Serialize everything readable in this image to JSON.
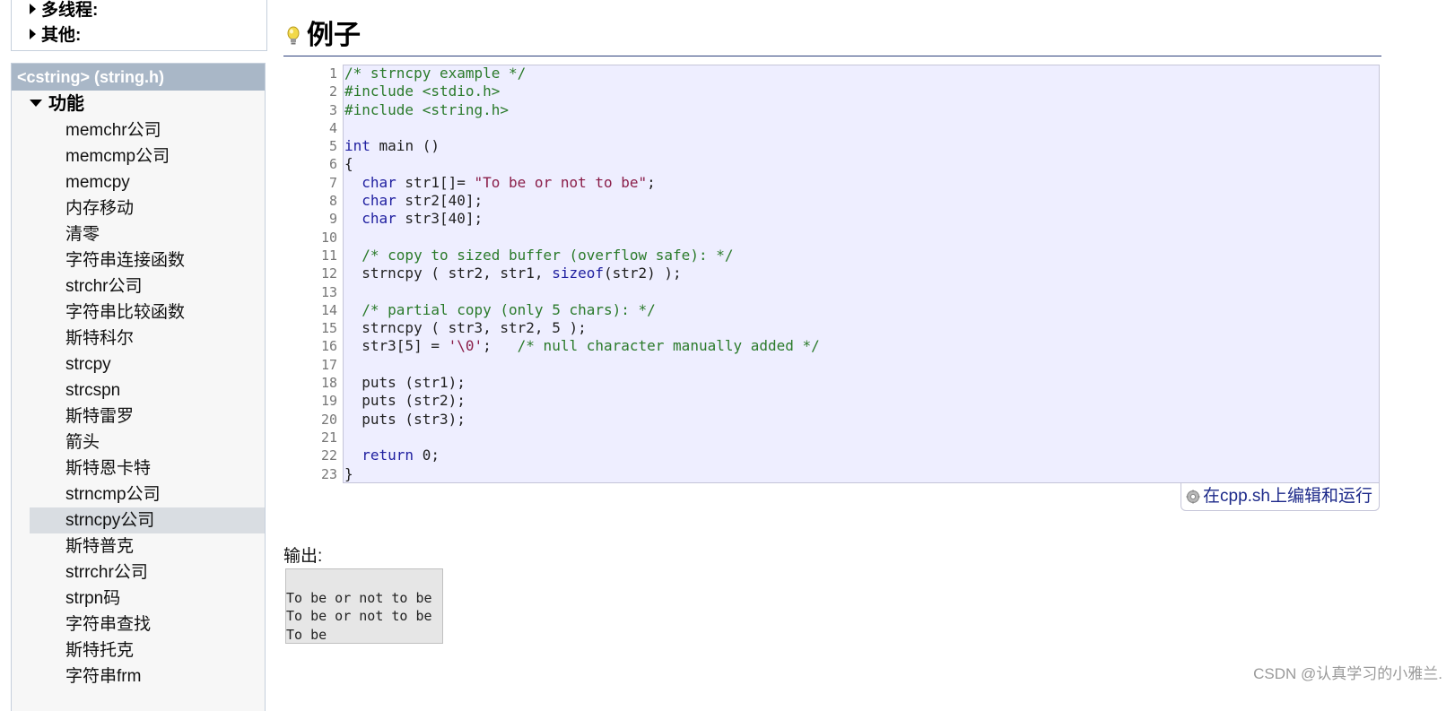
{
  "sidebar": {
    "categories": [
      {
        "label": "多线程:"
      },
      {
        "label": "其他:"
      }
    ],
    "header": "<cstring> (string.h)",
    "section_label": "功能",
    "items": [
      {
        "label": "memchr公司"
      },
      {
        "label": "memcmp公司"
      },
      {
        "label": "memcpy"
      },
      {
        "label": "内存移动"
      },
      {
        "label": "清零"
      },
      {
        "label": "字符串连接函数"
      },
      {
        "label": "strchr公司"
      },
      {
        "label": "字符串比较函数"
      },
      {
        "label": "斯特科尔"
      },
      {
        "label": "strcpy"
      },
      {
        "label": "strcspn"
      },
      {
        "label": "斯特雷罗"
      },
      {
        "label": "箭头"
      },
      {
        "label": "斯特恩卡特"
      },
      {
        "label": "strncmp公司"
      },
      {
        "label": "strncpy公司"
      },
      {
        "label": "斯特普克"
      },
      {
        "label": "strrchr公司"
      },
      {
        "label": "strpn码"
      },
      {
        "label": "字符串查找"
      },
      {
        "label": "斯特托克"
      },
      {
        "label": "字符串frm"
      }
    ],
    "active_item": "strncpy公司"
  },
  "main": {
    "heading": "例子",
    "line_numbers": [
      "1",
      "2",
      "3",
      "4",
      "5",
      "6",
      "7",
      "8",
      "9",
      "10",
      "11",
      "12",
      "13",
      "14",
      "15",
      "16",
      "17",
      "18",
      "19",
      "20",
      "21",
      "22",
      "23"
    ],
    "edit_link": "在cpp.sh上编辑和运行",
    "output_label": "输出:",
    "output_lines": [
      "To be or not to be",
      "To be or not to be",
      "To be"
    ]
  },
  "code": {
    "l1": "/* strncpy example */",
    "l2": "#include <stdio.h>",
    "l3": "#include <string.h>",
    "l5_kw": "int",
    "l5_rest": " main ()",
    "l6": "{",
    "l7_indent": "  ",
    "l7_kw": "char",
    "l7_mid": " str1[]= ",
    "l7_str": "\"To be or not to be\"",
    "l7_end": ";",
    "l8_kw": "char",
    "l8_rest": " str2[40];",
    "l9_kw": "char",
    "l9_rest": " str3[40];",
    "l11": "/* copy to sized buffer (overflow safe): */",
    "l12_a": "strncpy ( str2, str1, ",
    "l12_kw": "sizeof",
    "l12_b": "(str2) );",
    "l14": "/* partial copy (only 5 chars): */",
    "l15": "strncpy ( str3, str2, 5 );",
    "l16_a": "str3[5] = ",
    "l16_str": "'\\0'",
    "l16_b": ";   ",
    "l16_c": "/* null character manually added */",
    "l18": "puts (str1);",
    "l19": "puts (str2);",
    "l20": "puts (str3);",
    "l22_kw": "return",
    "l22_rest": " 0;",
    "l23": "}"
  },
  "watermark": "CSDN @认真学习的小雅兰.",
  "colors": {
    "code_bg": "#eeeeff",
    "sidebar_header_bg": "#a9b7c7",
    "comment": "#2a7a2a",
    "keyword": "#2020a0",
    "string": "#8a1d48",
    "link": "#1d2a8a"
  }
}
